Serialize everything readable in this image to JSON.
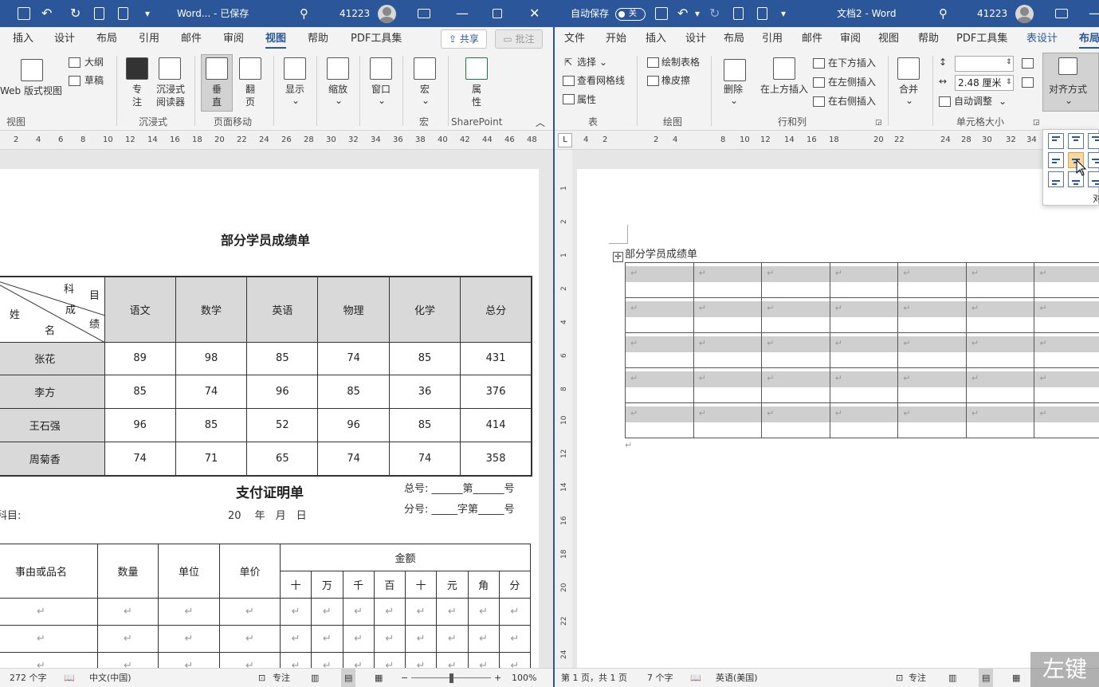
{
  "left": {
    "titlebar": {
      "title": "Word... - 已保存",
      "user": "41223"
    },
    "tabs": [
      "插入",
      "设计",
      "布局",
      "引用",
      "邮件",
      "审阅",
      "视图",
      "帮助",
      "PDF工具集"
    ],
    "active_tab": "视图",
    "share": "共享",
    "comment": "批注",
    "ribbon": {
      "web_view": "Web 版式视图",
      "outline": "大纲",
      "draft": "草稿",
      "focus": "专注",
      "reader": "沉浸式阅读器",
      "vertical": "垂直",
      "page": "翻页",
      "show": "显示",
      "zoom": "缩放",
      "window": "窗口",
      "macro": "宏",
      "props": "属性",
      "groups": [
        "视图",
        "沉浸式",
        "页面移动",
        "宏",
        "SharePoint"
      ]
    },
    "ruler": [
      "2",
      "4",
      "6",
      "8",
      "10",
      "12",
      "14",
      "16",
      "18",
      "20",
      "22",
      "24",
      "26",
      "28",
      "30",
      "32",
      "34",
      "36",
      "38",
      "40",
      "42",
      "44",
      "46",
      "48"
    ],
    "doc": {
      "title1": "部分学员成绩单",
      "header_diag": [
        "科",
        "目",
        "成",
        "绩",
        "姓",
        "名"
      ],
      "headers": [
        "语文",
        "数学",
        "英语",
        "物理",
        "化学",
        "总分"
      ],
      "rows": [
        {
          "name": "张花",
          "vals": [
            "89",
            "98",
            "85",
            "74",
            "85",
            "431"
          ]
        },
        {
          "name": "李方",
          "vals": [
            "85",
            "74",
            "96",
            "85",
            "36",
            "376"
          ]
        },
        {
          "name": "王石强",
          "vals": [
            "96",
            "85",
            "52",
            "96",
            "85",
            "414"
          ]
        },
        {
          "name": "周菊香",
          "vals": [
            "74",
            "71",
            "65",
            "74",
            "74",
            "358"
          ]
        }
      ],
      "title2": "支付证明单",
      "total_no": "总号: ______第______号",
      "sub_no": "分号: _____字第_____号",
      "subject": "科目:",
      "date": "20　 年　月　日",
      "t2_headers": [
        "事由或品名",
        "数量",
        "单位",
        "单价",
        "金额"
      ],
      "t2_digits": [
        "十",
        "万",
        "千",
        "百",
        "十",
        "元",
        "角",
        "分"
      ]
    },
    "status": {
      "words": "272 个字",
      "lang": "中文(中国)",
      "focus": "专注",
      "zoom": "100%"
    }
  },
  "right": {
    "titlebar": {
      "autosave": "自动保存",
      "autosave_state": "关",
      "title": "文档2 - Word",
      "user": "41223"
    },
    "tabs": [
      "文件",
      "开始",
      "插入",
      "设计",
      "布局",
      "引用",
      "邮件",
      "审阅",
      "视图",
      "帮助",
      "PDF工具集",
      "表设计",
      "布局"
    ],
    "active_tab": "布局",
    "ribbon": {
      "select": "选择",
      "gridlines": "查看网格线",
      "properties": "属性",
      "draw_table": "绘制表格",
      "eraser": "橡皮擦",
      "delete": "删除",
      "insert_above": "在上方插入",
      "insert_below": "在下方插入",
      "insert_left": "在左侧插入",
      "insert_right": "在右侧插入",
      "merge": "合并",
      "width": "2.48 厘米",
      "autofit": "自动调整",
      "align": "对齐方式",
      "groups": [
        "表",
        "绘图",
        "行和列",
        "单元格大小"
      ]
    },
    "ruler": [
      "4",
      "2",
      "2",
      "4",
      "8",
      "10",
      "12",
      "14",
      "16",
      "18",
      "20",
      "22",
      "24",
      "28",
      "30",
      "32",
      "34",
      "36"
    ],
    "vruler": [
      "1",
      "2",
      "1",
      "2",
      "4",
      "6",
      "8",
      "10",
      "12",
      "14",
      "16",
      "18",
      "20",
      "22",
      "24"
    ],
    "doc": {
      "title": "部分学员成绩单",
      "rows": 5,
      "cols": 7
    },
    "dropdown_label": "对",
    "status": {
      "page": "第 1 页，共 1 页",
      "words": "7 个字",
      "lang": "英语(美国)",
      "focus": "专注"
    }
  },
  "watermark": "左键"
}
